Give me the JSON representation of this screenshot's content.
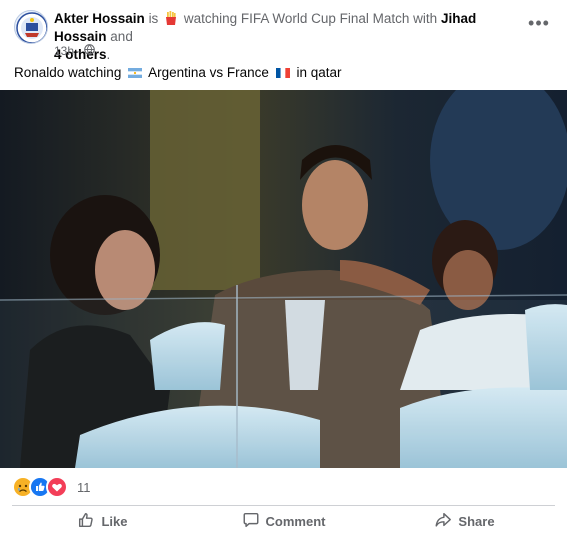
{
  "post": {
    "author": "Akter Hossain",
    "is_text": "is",
    "activity": "watching FIFA World Cup Final Match with",
    "tagged_person": "Jihad Hossain",
    "and_text": "and",
    "others": "4 others",
    "period": ".",
    "time": "13h",
    "privacy_separator": "·",
    "caption_part1": "Ronaldo watching",
    "caption_part2": "Argentina vs France",
    "caption_part3": "in qatar",
    "reaction_count": "11",
    "more_label": "•••"
  },
  "actions": {
    "like": "Like",
    "comment": "Comment",
    "share": "Share"
  },
  "icons": {
    "activity": "fries-emoji-icon",
    "privacy": "globe-icon",
    "flag_argentina": "argentina-flag-icon",
    "flag_france": "france-flag-icon",
    "reactions": [
      "sad-reaction-icon",
      "like-reaction-icon",
      "love-reaction-icon"
    ]
  },
  "colors": {
    "secondary_text": "#65676b",
    "like_blue": "#1877f2",
    "love_red": "#f33e58",
    "sad_yellow": "#f7b125"
  }
}
